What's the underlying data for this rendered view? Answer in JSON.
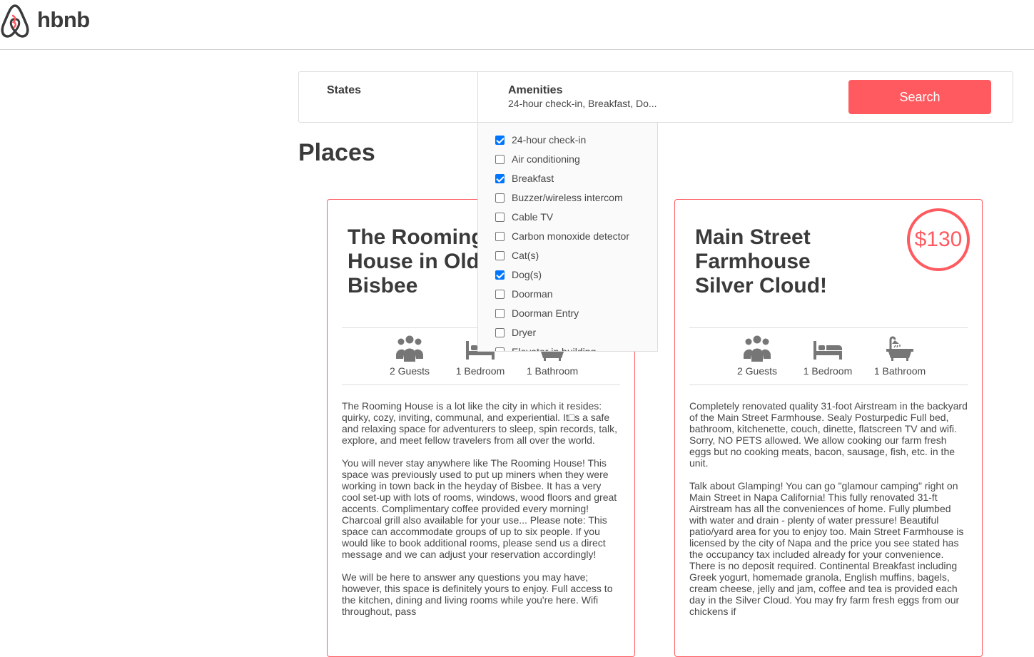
{
  "header": {
    "brand": "hbnb"
  },
  "filters": {
    "states_label": "States",
    "amenities_label": "Amenities",
    "amenities_selected": "24-hour check-in, Breakfast, Do...",
    "search_label": "Search"
  },
  "amenities_list": [
    {
      "label": "24-hour check-in",
      "checked": true
    },
    {
      "label": "Air conditioning",
      "checked": false
    },
    {
      "label": "Breakfast",
      "checked": true
    },
    {
      "label": "Buzzer/wireless intercom",
      "checked": false
    },
    {
      "label": "Cable TV",
      "checked": false
    },
    {
      "label": "Carbon monoxide detector",
      "checked": false
    },
    {
      "label": "Cat(s)",
      "checked": false
    },
    {
      "label": "Dog(s)",
      "checked": true
    },
    {
      "label": "Doorman",
      "checked": false
    },
    {
      "label": "Doorman Entry",
      "checked": false
    },
    {
      "label": "Dryer",
      "checked": false
    },
    {
      "label": "Elevator in building",
      "checked": false
    }
  ],
  "places": {
    "title": "Places",
    "items": [
      {
        "name": "The Rooming House in Old Bisbee",
        "guests": "2 Guests",
        "bedrooms": "1 Bedroom",
        "bathrooms": "1 Bathroom",
        "description": [
          "The Rooming House is a lot like the city in which it resides: quirky, cozy, inviting, communal, and experiential. It□s a safe and relaxing space for adventurers to sleep, spin records, talk, explore, and meet fellow travelers from all over the world.",
          "You will never stay anywhere like The Rooming House! This space was previously used to put up miners when they were working in town back in the heyday of Bisbee. It has a very cool set-up with lots of rooms, windows, wood floors and great accents. Complimentary coffee provided every morning! Charcoal grill also available for your use... Please note: This space can accommodate groups of up to six people. If you would like to book additional rooms, please send us a direct message and we can adjust your reservation accordingly!",
          "We will be here to answer any questions you may have; however, this space is definitely yours to enjoy. Full access to the kitchen, dining and living rooms while you're here. Wifi throughout, pass"
        ]
      },
      {
        "name": "Main Street Farmhouse Silver Cloud!",
        "price": "$130",
        "guests": "2 Guests",
        "bedrooms": "1 Bedroom",
        "bathrooms": "1 Bathroom",
        "description": [
          "Completely renovated quality 31-foot Airstream in the backyard of the Main Street Farmhouse. Sealy Posturpedic Full bed, bathroom, kitchenette, couch, dinette, flatscreen TV and wifi. Sorry, NO PETS allowed. We allow cooking our farm fresh eggs but no cooking meats, bacon, sausage, fish, etc. in the unit.",
          "Talk about Glamping! You can go \"glamour camping\" right on Main Street in Napa California! This fully renovated 31-ft Airstream has all the conveniences of home. Fully plumbed with water and drain - plenty of water pressure! Beautiful patio/yard area for you to enjoy too. Main Street Farmhouse is licensed by the city of Napa and the price you see stated has the occupancy tax included already for your convenience. There is no deposit required. Continental Breakfast including Greek yogurt, homemade granola, English muffins, bagels, cream cheese, jelly and jam, coffee and tea is provided each day in the Silver Cloud. You may fry farm fresh eggs from our chickens if"
        ]
      }
    ]
  },
  "colors": {
    "accent": "#ff5a5f",
    "text": "#484848",
    "checkbox": "#0075ff"
  },
  "icons": [
    "airbnb-logo-icon",
    "guests-icon",
    "bed-icon",
    "bathtub-icon",
    "shower-icon"
  ]
}
